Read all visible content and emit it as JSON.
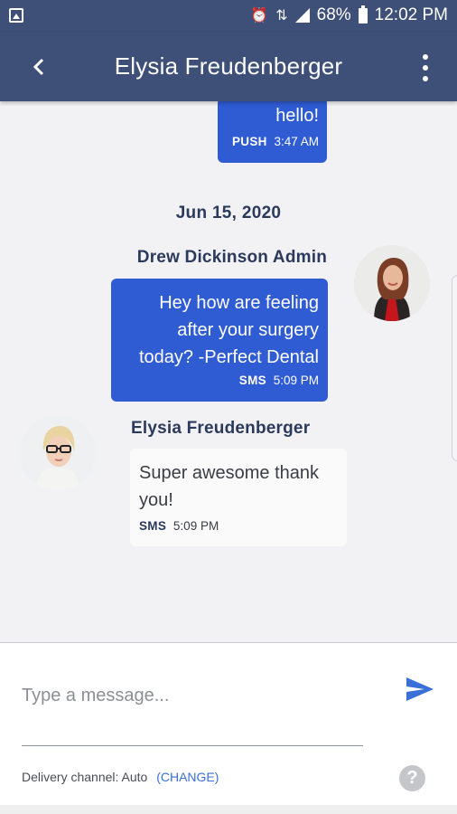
{
  "status_bar": {
    "battery": "68%",
    "time": "12:02 PM"
  },
  "header": {
    "title": "Elysia Freudenberger"
  },
  "messages": [
    {
      "direction": "outgoing",
      "text": "hello!",
      "channel": "PUSH",
      "time": "3:47 AM"
    },
    {
      "direction": "outgoing",
      "sender": "Drew Dickinson Admin",
      "text_lines": [
        "Hey how are feeling",
        "after your surgery",
        "today? -Perfect Dental"
      ],
      "channel": "SMS",
      "time": "5:09 PM"
    },
    {
      "direction": "incoming",
      "sender": "Elysia Freudenberger",
      "text_lines": [
        "Super awesome thank",
        "you!"
      ],
      "channel": "SMS",
      "time": "5:09 PM"
    }
  ],
  "date_separator": "Jun 15, 2020",
  "composer": {
    "placeholder": "Type a message...",
    "delivery_label": "Delivery channel: Auto",
    "change_label": "(CHANGE)"
  },
  "colors": {
    "header_bg": "#3e5078",
    "outgoing_bubble": "#2f5bd3",
    "send_icon": "#3b6fd8",
    "link": "#3b6fd8"
  },
  "icons": {
    "back": "back-arrow-icon",
    "more": "more-vertical-icon",
    "send": "send-icon",
    "help": "help-icon"
  }
}
